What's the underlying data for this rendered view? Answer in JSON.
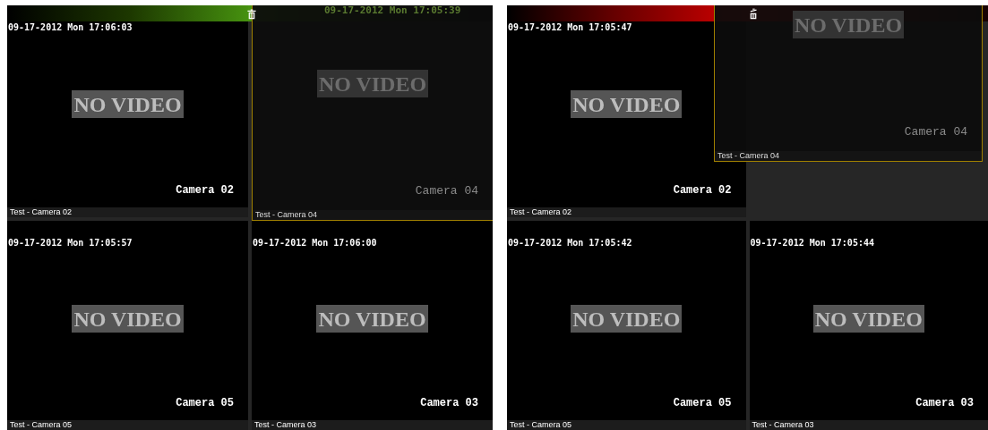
{
  "panels": [
    {
      "over_trash": false,
      "tiles": [
        {
          "kind": "camera",
          "timestamp": "09-17-2012 Mon 17:06:03",
          "message": "NO VIDEO",
          "camera": "Camera 02",
          "caption": "Test - Camera 02"
        },
        {
          "kind": "empty"
        },
        {
          "kind": "camera",
          "timestamp": "09-17-2012 Mon 17:05:57",
          "message": "NO VIDEO",
          "camera": "Camera 05",
          "caption": "Test - Camera 05"
        },
        {
          "kind": "camera",
          "timestamp": "09-17-2012 Mon 17:06:00",
          "message": "NO VIDEO",
          "camera": "Camera 03",
          "caption": "Test - Camera 03"
        }
      ],
      "dragged_tile": {
        "timestamp": "09-17-2012 Mon 17:05:39",
        "message": "NO VIDEO",
        "camera": "Camera 04",
        "caption": "Test - Camera 04"
      }
    },
    {
      "over_trash": true,
      "tiles": [
        {
          "kind": "camera",
          "timestamp": "09-17-2012 Mon 17:05:47",
          "message": "NO VIDEO",
          "camera": "Camera 02",
          "caption": "Test - Camera 02"
        },
        {
          "kind": "empty"
        },
        {
          "kind": "camera",
          "timestamp": "09-17-2012 Mon 17:05:42",
          "message": "NO VIDEO",
          "camera": "Camera 05",
          "caption": "Test - Camera 05"
        },
        {
          "kind": "camera",
          "timestamp": "09-17-2012 Mon 17:05:44",
          "message": "NO VIDEO",
          "camera": "Camera 03",
          "caption": "Test - Camera 03"
        }
      ],
      "dragged_tile": {
        "message": "NO VIDEO",
        "camera": "Camera 04",
        "caption": "Test - Camera 04"
      }
    }
  ]
}
